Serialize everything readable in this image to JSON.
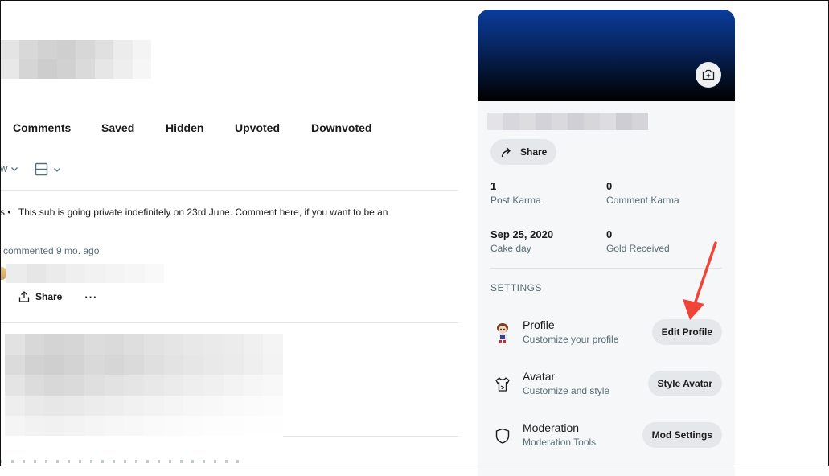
{
  "tabs": [
    {
      "label": "Comments"
    },
    {
      "label": "Saved"
    },
    {
      "label": "Hidden"
    },
    {
      "label": "Upvoted"
    },
    {
      "label": "Downvoted"
    }
  ],
  "toolbar": {
    "sort_partial": "w",
    "view_icon": "layout-icon"
  },
  "post": {
    "prefix": "s •",
    "text": "This sub is going private indefinitely on 23rd June. Comment here, if you want to be an",
    "meta": "commented 9 mo. ago",
    "share_label": "Share",
    "more_label": "···"
  },
  "card": {
    "share_label": "Share",
    "stats": [
      {
        "value": "1",
        "label": "Post Karma"
      },
      {
        "value": "0",
        "label": "Comment Karma"
      },
      {
        "value": "Sep 25, 2020",
        "label": "Cake day"
      },
      {
        "value": "0",
        "label": "Gold Received"
      }
    ],
    "settings_title": "SETTINGS",
    "settings": [
      {
        "title": "Profile",
        "subtitle": "Customize your profile",
        "button": "Edit Profile",
        "icon": "avatar-image-icon"
      },
      {
        "title": "Avatar",
        "subtitle": "Customize and style",
        "button": "Style Avatar",
        "icon": "shirt-icon"
      },
      {
        "title": "Moderation",
        "subtitle": "Moderation Tools",
        "button": "Mod Settings",
        "icon": "shield-icon"
      }
    ]
  },
  "colors": {
    "banner_top": "#0a3d9b",
    "banner_bottom": "#000000",
    "annotation_arrow": "#f04438"
  }
}
